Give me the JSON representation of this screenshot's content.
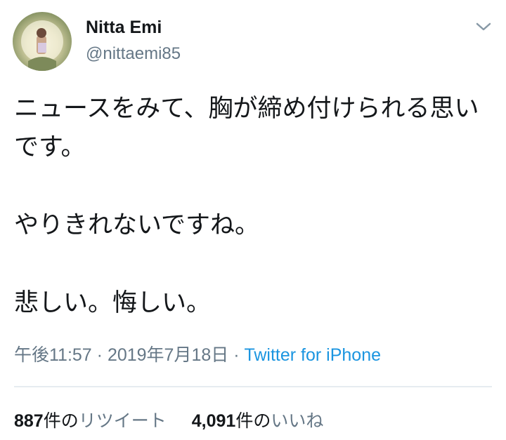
{
  "user": {
    "display_name": "Nitta Emi",
    "handle": "@nittaemi85"
  },
  "tweet": {
    "paragraphs": [
      "ニュースをみて、胸が締め付けられる思いです。",
      "やりきれないですね。",
      "悲しい。悔しい。"
    ],
    "time": "午後11:57",
    "separator": " · ",
    "date": "2019年7月18日",
    "source": "Twitter for iPhone"
  },
  "stats": {
    "retweets": {
      "count": "887",
      "unit": "件の",
      "label": "リツイート"
    },
    "likes": {
      "count": "4,091",
      "unit": "件の",
      "label": "いいね"
    }
  },
  "icons": {
    "menu": "chevron-down-icon",
    "avatar": "profile-photo"
  },
  "colors": {
    "text": "#14171a",
    "secondary": "#657786",
    "link": "#1b95e0",
    "divider": "#e6ecf0"
  }
}
